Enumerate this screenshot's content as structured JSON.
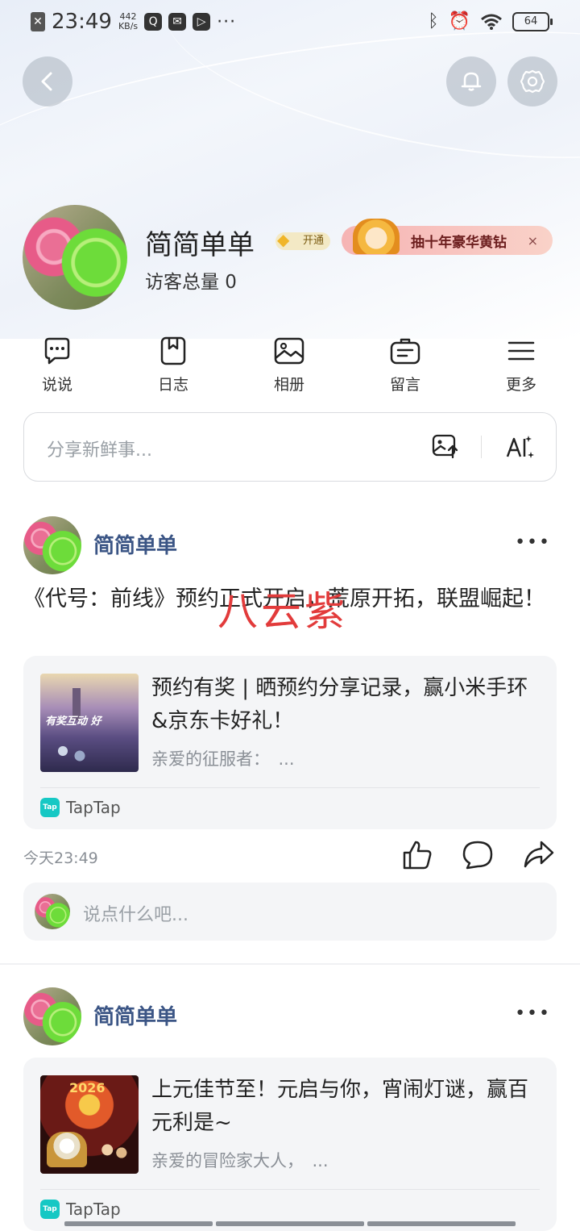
{
  "status_bar": {
    "time": "23:49",
    "speed_value": "442",
    "speed_unit": "KB/s",
    "battery": "64"
  },
  "profile": {
    "name": "简简单单",
    "vip_label": "开通",
    "promo_text": "抽十年豪华黄钻",
    "promo_close": "×",
    "visitors": "访客总量 0"
  },
  "quick_nav": [
    {
      "label": "说说",
      "icon": "chat-bubble-icon"
    },
    {
      "label": "日志",
      "icon": "bookmark-note-icon"
    },
    {
      "label": "相册",
      "icon": "image-icon"
    },
    {
      "label": "留言",
      "icon": "message-board-icon"
    },
    {
      "label": "更多",
      "icon": "menu-icon"
    }
  ],
  "share_box": {
    "placeholder": "分享新鲜事..."
  },
  "posts": [
    {
      "author": "简简单单",
      "text": "《代号：前线》预约正式开启，荒原开拓，联盟崛起！",
      "card_title": "预约有奖 | 晒预约分享记录，赢小米手环&京东卡好礼！",
      "card_desc": "亲爱的征服者：　...",
      "card_source": "TapTap",
      "thumb_caption": "有奖互动 好",
      "time": "今天23:49",
      "comment_placeholder": "说点什么吧..."
    },
    {
      "author": "简简单单",
      "card_title": "上元佳节至！元启与你，宵闹灯谜，赢百元利是~",
      "card_desc": "亲爱的冒险家大人，　...",
      "card_source": "TapTap",
      "thumb_caption": "2026"
    }
  ],
  "watermark": "八云紫",
  "colors": {
    "author_name": "#3b5585",
    "watermark": "#e23b3b",
    "taptap": "#16c8c4"
  }
}
